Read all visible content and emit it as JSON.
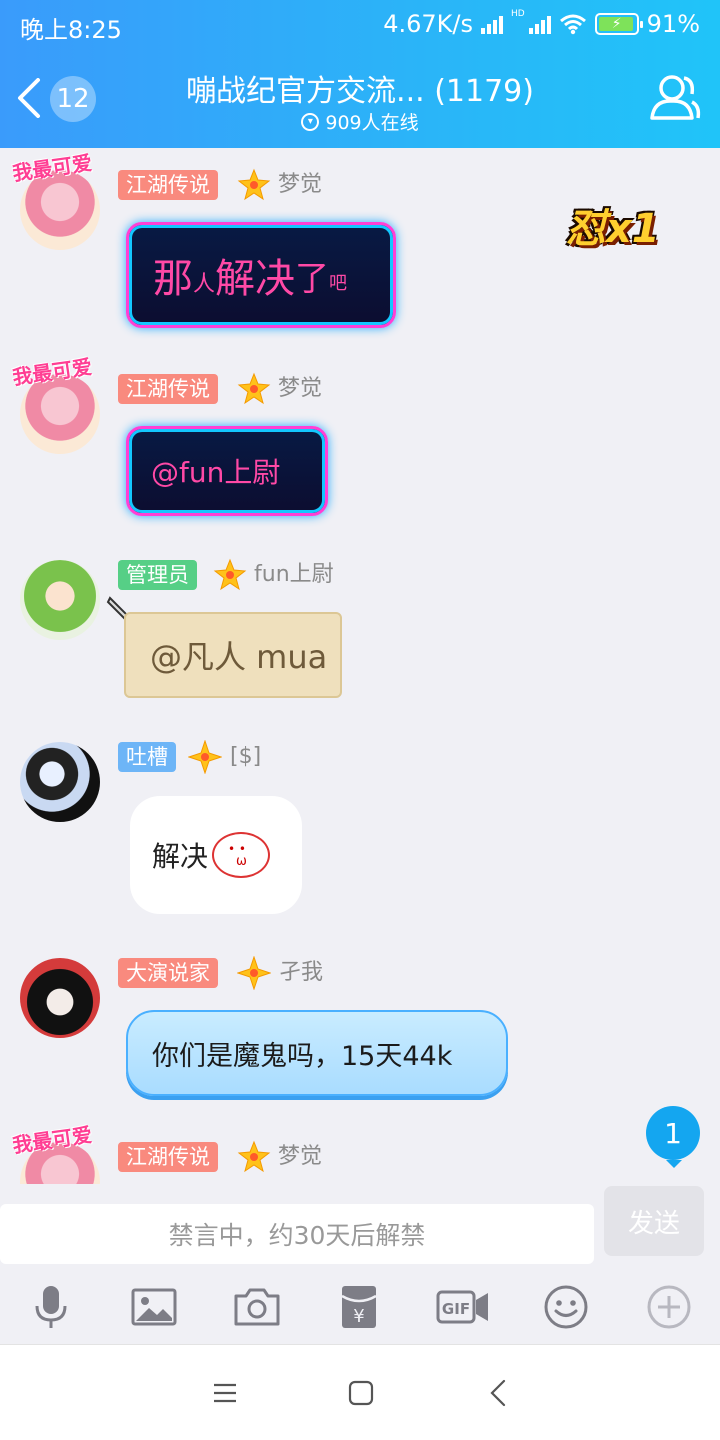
{
  "status": {
    "time": "晚上8:25",
    "speed": "4.67K/s",
    "hd": "HD",
    "battery": "91%"
  },
  "header": {
    "back_count": "12",
    "title": "嘣战纪官方交流... (1179)",
    "online": "909人在线"
  },
  "effect": {
    "label": "怼x1"
  },
  "messages": [
    {
      "pendant": "我最可爱",
      "tag": "江湖传说",
      "tag_color": "#f98a7e",
      "name": "梦觉",
      "parts": [
        "那",
        "人",
        "解决",
        "了",
        "吧"
      ]
    },
    {
      "pendant": "我最可爱",
      "tag": "江湖传说",
      "tag_color": "#f98a7e",
      "name": "梦觉",
      "text": "@fun上尉"
    },
    {
      "tag": "管理员",
      "tag_color": "#56cf86",
      "name": "fun上尉",
      "text": "@凡人 mua"
    },
    {
      "tag": "吐槽",
      "tag_color": "#6db5f7",
      "name": "[$]",
      "text": "解决"
    },
    {
      "tag": "大演说家",
      "tag_color": "#f98a7e",
      "name": "孑我",
      "text": "你们是魔鬼吗，15天44k"
    },
    {
      "pendant": "我最可爱",
      "tag": "江湖传说",
      "tag_color": "#f98a7e",
      "name": "梦觉"
    }
  ],
  "unread_count": "1",
  "input": {
    "placeholder": "禁言中，约30天后解禁",
    "send_label": "发送"
  },
  "toolbar": [
    "mic-icon",
    "image-icon",
    "camera-icon",
    "red-packet-icon",
    "gif-icon",
    "emoji-icon",
    "plus-icon"
  ],
  "colors": {
    "header_start": "#3a9bfb",
    "header_end": "#20c4f9",
    "accent": "#14a6f0",
    "icon_gray": "#7d7d86"
  }
}
